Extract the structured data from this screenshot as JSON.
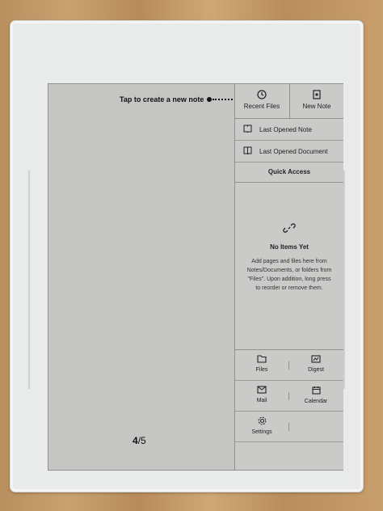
{
  "hint": {
    "text": "Tap to create a new note"
  },
  "page_indicator": {
    "current": "4",
    "total": "/5"
  },
  "top_buttons": {
    "recent_files": {
      "label": "Recent Files",
      "icon": "clock-icon"
    },
    "new_note": {
      "label": "New Note",
      "icon": "new-note-icon"
    }
  },
  "menu": {
    "last_note": {
      "label": "Last Opened Note",
      "icon": "notebook-icon"
    },
    "last_document": {
      "label": "Last Opened Document",
      "icon": "book-icon"
    }
  },
  "quick_access": {
    "header": "Quick Access",
    "empty_icon": "link-icon",
    "empty_title": "No Items Yet",
    "empty_desc": "Add pages and files here from Notes/Documents, or folders from \"Files\". Upon addition, long press to reorder or remove them."
  },
  "apps": {
    "files": {
      "label": "Files",
      "icon": "folder-icon"
    },
    "digest": {
      "label": "Digest",
      "icon": "digest-icon"
    },
    "mail": {
      "label": "Mail",
      "icon": "mail-icon"
    },
    "calendar": {
      "label": "Calendar",
      "icon": "calendar-icon"
    },
    "settings": {
      "label": "Settings",
      "icon": "gear-icon"
    }
  }
}
